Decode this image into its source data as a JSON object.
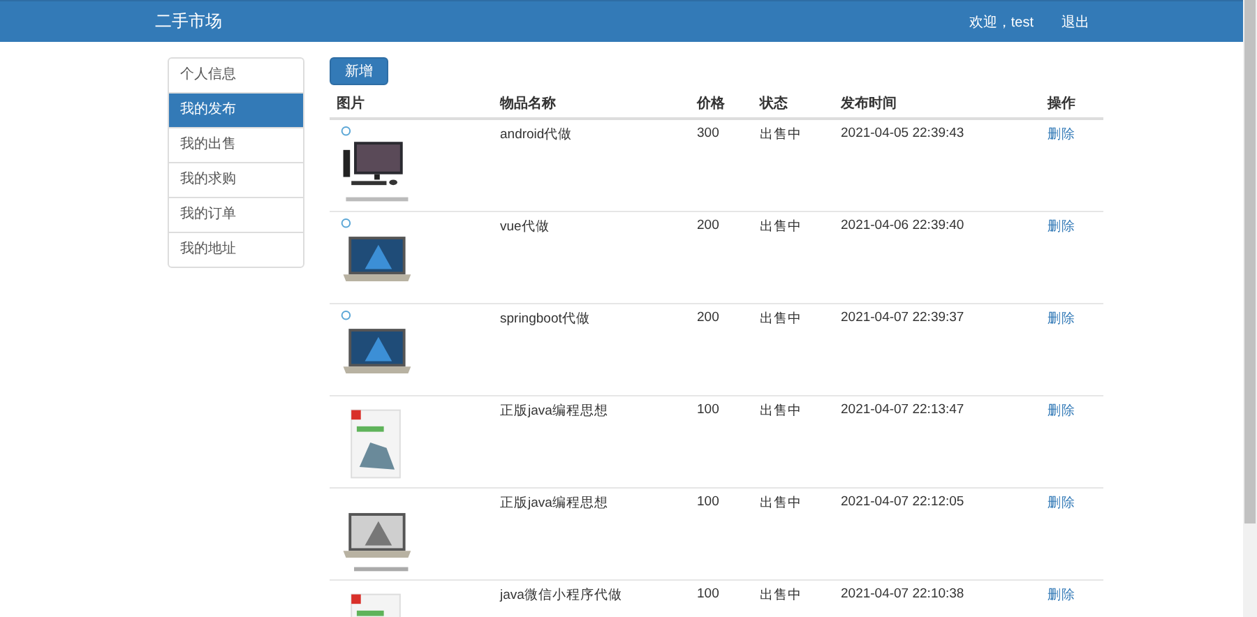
{
  "navbar": {
    "brand": "二手市场",
    "welcome": "欢迎，test",
    "logout": "退出"
  },
  "sidebar": {
    "items": [
      {
        "label": "个人信息",
        "selected": false
      },
      {
        "label": "我的发布",
        "selected": true
      },
      {
        "label": "我的出售",
        "selected": false
      },
      {
        "label": "我的求购",
        "selected": false
      },
      {
        "label": "我的订单",
        "selected": false
      },
      {
        "label": "我的地址",
        "selected": false
      }
    ]
  },
  "add_button": "新增",
  "table": {
    "columns": [
      "图片",
      "物品名称",
      "价格",
      "状态",
      "发布时间",
      "操作"
    ],
    "rows": [
      {
        "name": "android代做",
        "price": "300",
        "status": "出售中",
        "time": "2021-04-05 22:39:43",
        "action": "删除"
      },
      {
        "name": "vue代做",
        "price": "200",
        "status": "出售中",
        "time": "2021-04-06 22:39:40",
        "action": "删除"
      },
      {
        "name": "springboot代做",
        "price": "200",
        "status": "出售中",
        "time": "2021-04-07 22:39:37",
        "action": "删除"
      },
      {
        "name": "正版java编程思想",
        "price": "100",
        "status": "出售中",
        "time": "2021-04-07 22:13:47",
        "action": "删除"
      },
      {
        "name": "正版java编程思想",
        "price": "100",
        "status": "出售中",
        "time": "2021-04-07 22:12:05",
        "action": "删除"
      },
      {
        "name": "java微信小程序代做",
        "price": "100",
        "status": "出售中",
        "time": "2021-04-07 22:10:38",
        "action": "删除"
      }
    ]
  }
}
